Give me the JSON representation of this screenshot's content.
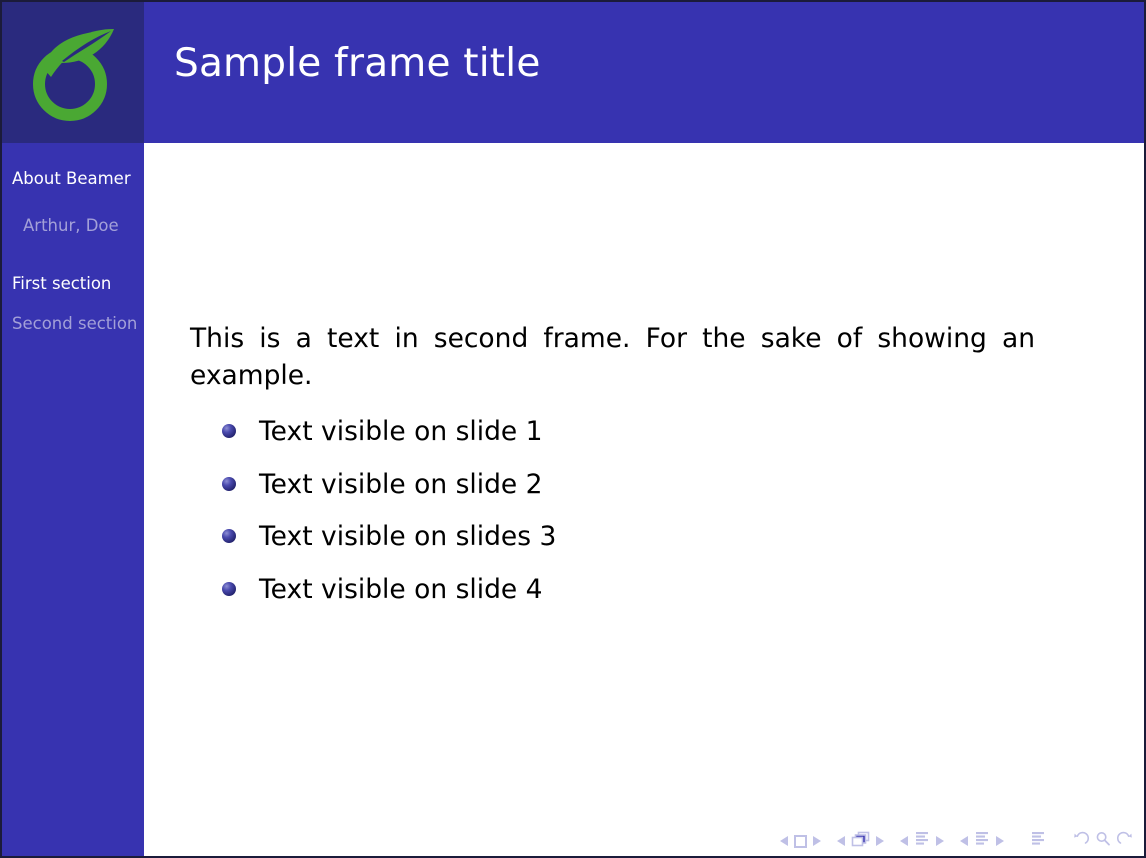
{
  "slide": {
    "frame_title": "Sample frame title",
    "logo_icon": "sprout-leaf-logo",
    "colors": {
      "header_blue": "#3733b0",
      "logo_block_blue": "#2a2a7e",
      "sidebar_blue": "#3733b0",
      "sidebar_active_text": "#ffffff",
      "sidebar_dim_text": "#a3a0d8",
      "body_text": "#000000",
      "bullet_ball": "#262673",
      "nav_symbol": "#bfc0e6",
      "logo_green": "#4aa833",
      "page_background": "#ffffff"
    }
  },
  "sidebar": {
    "presentation_title": "About Beamer",
    "author": "Arthur, Doe",
    "sections": [
      {
        "label": "First section",
        "state": "active"
      },
      {
        "label": "Second section",
        "state": "dim"
      }
    ]
  },
  "body": {
    "paragraph": "This is a text in second frame. For the sake of showing an example.",
    "items": [
      "Text visible on slide 1",
      "Text visible on slide 2",
      "Text visible on slides 3",
      "Text visible on slide 4"
    ]
  },
  "navigation": {
    "groups": [
      {
        "name": "slide-navigation",
        "icon": "square-icon"
      },
      {
        "name": "frame-navigation",
        "icon": "stacked-frames-icon"
      },
      {
        "name": "subsection-navigation",
        "icon": "lines-icon"
      },
      {
        "name": "section-navigation",
        "icon": "lines-icon"
      }
    ],
    "presentation_icon": "document-lines-icon",
    "history_icons": [
      "back-arrow-icon",
      "search-icon",
      "forward-arrow-icon"
    ]
  }
}
